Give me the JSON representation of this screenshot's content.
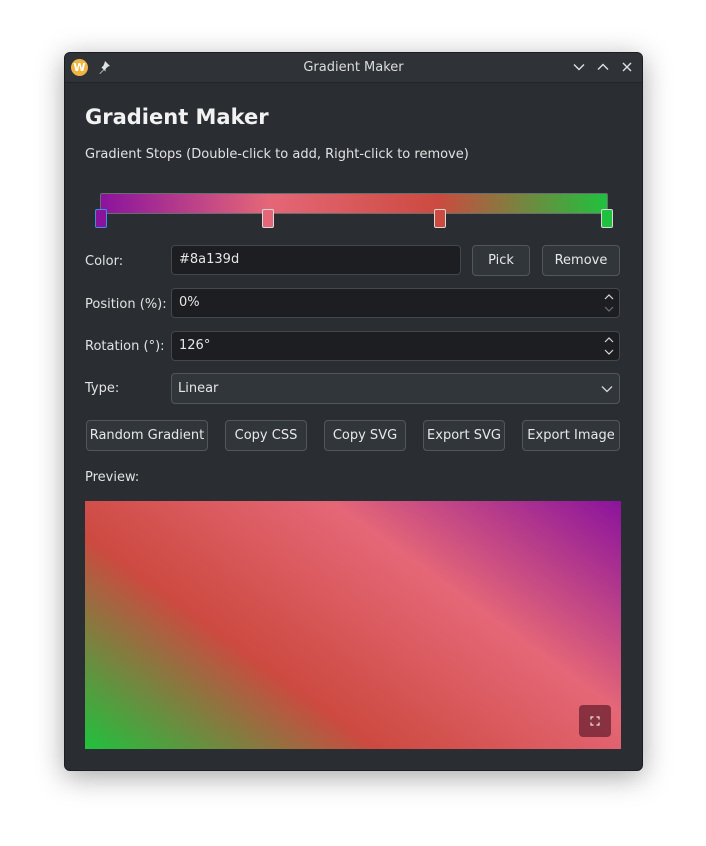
{
  "window": {
    "title": "Gradient Maker",
    "app_icon_letter": "W",
    "icons": [
      "pin-icon",
      "minimize-icon",
      "maximize-icon",
      "close-icon"
    ]
  },
  "main": {
    "heading": "Gradient Maker",
    "stops_label": "Gradient Stops (Double-click to add, Right-click to remove)",
    "stops": [
      {
        "color": "#8a139d",
        "position": 0
      },
      {
        "color": "#e56777",
        "position": 33
      },
      {
        "color": "#cc4a40",
        "position": 67
      },
      {
        "color": "#1fc13e",
        "position": 100
      }
    ],
    "color_label": "Color:",
    "color_value": "#8a139d",
    "pick_label": "Pick",
    "remove_label": "Remove",
    "position_label": "Position (%):",
    "position_value": "0%",
    "rotation_label": "Rotation (°):",
    "rotation_value": "126°",
    "type_label": "Type:",
    "type_value": "Linear",
    "buttons": [
      "Random Gradient",
      "Copy CSS",
      "Copy SVG",
      "Export SVG",
      "Export Image"
    ],
    "preview_label": "Preview:"
  },
  "colors": {
    "window_bg": "#2a2e32",
    "field_bg": "#1c1e21",
    "button_bg": "#31363b",
    "selected_handle_border": "#3d8fe0"
  }
}
